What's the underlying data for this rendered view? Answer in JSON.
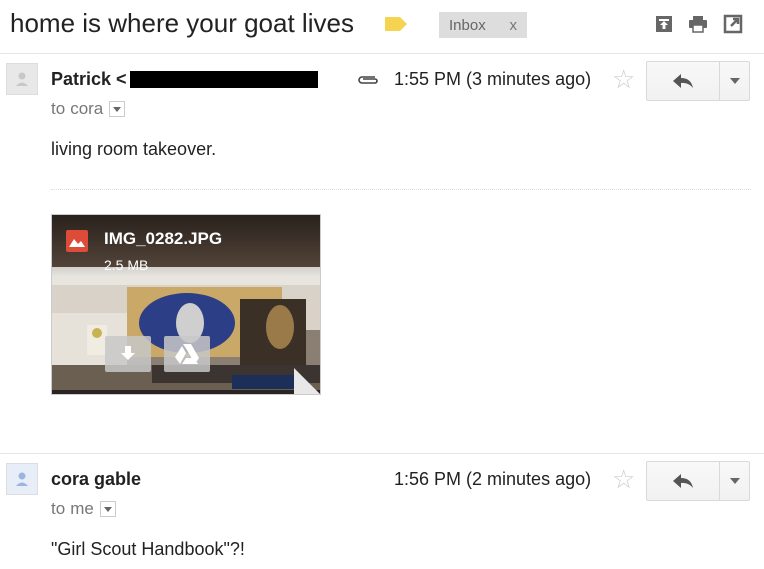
{
  "thread": {
    "subject": "home is where your goat lives",
    "label": "Inbox",
    "label_remove": "x",
    "icons": [
      "archive-icon",
      "print-icon",
      "new-window-icon"
    ]
  },
  "messages": [
    {
      "sender": "Patrick <",
      "recipient_prefix": "to ",
      "recipient": "cora",
      "time": "1:55 PM (3 minutes ago)",
      "has_attachment": true,
      "body": "living room takeover.",
      "attachment": {
        "filename": "IMG_0282.JPG",
        "size": "2.5 MB"
      }
    },
    {
      "sender": "cora gable",
      "recipient_prefix": "to ",
      "recipient": "me",
      "time": "1:56 PM (2 minutes ago)",
      "has_attachment": false,
      "body": "\"Girl Scout Handbook\"?!"
    }
  ],
  "colors": {
    "label_tag": "#f5d451",
    "chip_bg": "#dddddd",
    "drive_icon": "#ffffff",
    "image_icon": "#dd4b39"
  }
}
